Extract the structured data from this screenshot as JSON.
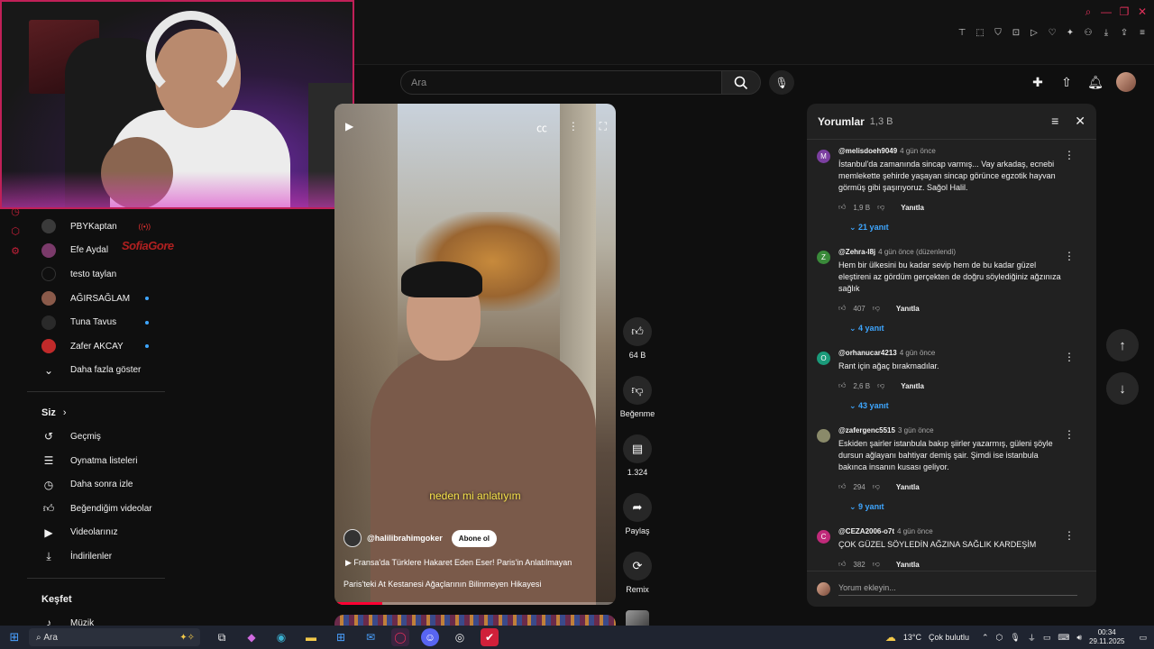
{
  "search": {
    "placeholder": "Ara"
  },
  "sidebar": {
    "subscriptions": [
      {
        "name": "PBYKaptan",
        "badge": "live",
        "live_label": "((•))"
      },
      {
        "name": "Efe Aydal",
        "badge": ""
      },
      {
        "name": "testo taylan",
        "badge": ""
      },
      {
        "name": "AĞIRSAĞLAM",
        "badge": "dot"
      },
      {
        "name": "Tuna Tavus",
        "badge": "dot"
      },
      {
        "name": "Zafer AKCAY",
        "badge": "dot"
      }
    ],
    "show_more": "Daha fazla göster",
    "you_title": "Siz",
    "you_items": [
      {
        "label": "Geçmiş",
        "icon": "history-icon"
      },
      {
        "label": "Oynatma listeleri",
        "icon": "playlist-icon"
      },
      {
        "label": "Daha sonra izle",
        "icon": "clock-icon"
      },
      {
        "label": "Beğendiğim videolar",
        "icon": "like-icon"
      },
      {
        "label": "Videolarınız",
        "icon": "play-square-icon"
      },
      {
        "label": "İndirilenler",
        "icon": "download-icon"
      }
    ],
    "explore_title": "Keşfet",
    "explore_items": [
      {
        "label": "Müzik",
        "icon": "music-icon"
      }
    ]
  },
  "watermark": "SofiaGore",
  "short": {
    "caption": "neden mi anlatıyım",
    "channel": "@halilibrahimgoker",
    "subscribe_label": "Abone ol",
    "title_line1": "Fransa'da Türklere Hakaret Eden Eser! Paris'in Anlatılmayan",
    "title_line2": "Paris'teki At Kestanesi Ağaçlarının Bilinmeyen Hikayesi",
    "progress": 0.17
  },
  "actions": {
    "like_count": "64 B",
    "dislike_label": "Beğenme",
    "comment_count": "1.324",
    "share_label": "Paylaş",
    "remix_label": "Remix"
  },
  "comments": {
    "title": "Yorumlar",
    "count": "1,3 B",
    "add_placeholder": "Yorum ekleyin...",
    "reply_label": "Yanıtla",
    "items": [
      {
        "avatar_letter": "M",
        "avatar_color": "#7b3fa0",
        "author": "@melisdoeh9049",
        "time": "4 gün önce",
        "text": "İstanbul'da zamanında sincap varmış... Vay arkadaş, ecnebi memlekette şehirde yaşayan sincap görünce egzotik hayvan görmüş gibi şaşırıyoruz. Sağol Halil.",
        "likes": "1,9 B",
        "replies": "21 yanıt"
      },
      {
        "avatar_letter": "Z",
        "avatar_color": "#3a8a3a",
        "author": "@Zehra-l8j",
        "time": "4 gün önce (düzenlendi)",
        "text": "Hem bir ülkesini bu kadar sevip hem de bu kadar güzel eleştireni az gördüm gerçekten de doğru söylediğiniz ağzınıza sağlık",
        "likes": "407",
        "replies": "4 yanıt"
      },
      {
        "avatar_letter": "O",
        "avatar_color": "#1a9a7a",
        "author": "@orhanucar4213",
        "time": "4 gün önce",
        "text": "Rant için ağaç bırakmadılar.",
        "likes": "2,6 B",
        "replies": "43 yanıt"
      },
      {
        "avatar_letter": "",
        "avatar_color": "#8a8a6a",
        "author": "@zafergenc5515",
        "time": "3 gün önce",
        "text": "Eskiden şairler istanbula bakıp şiirler yazarmış, güleni şöyle dursun ağlayanı bahtiyar demiş şair. Şimdi ise istanbula bakınca insanın kusası geliyor.",
        "likes": "294",
        "replies": "9 yanıt"
      },
      {
        "avatar_letter": "C",
        "avatar_color": "#c02a7a",
        "author": "@CEZA2006-o7t",
        "time": "4 gün önce",
        "text": "ÇOK GÜZEL SÖYLEDİN AĞZINA SAĞLIK KARDEŞİM",
        "likes": "382",
        "replies": ""
      }
    ]
  },
  "taskbar": {
    "search_label": "Ara",
    "weather": "13°C",
    "weather_desc": "Çok bulutlu",
    "time": "00:34",
    "date": "29.11.2025"
  }
}
